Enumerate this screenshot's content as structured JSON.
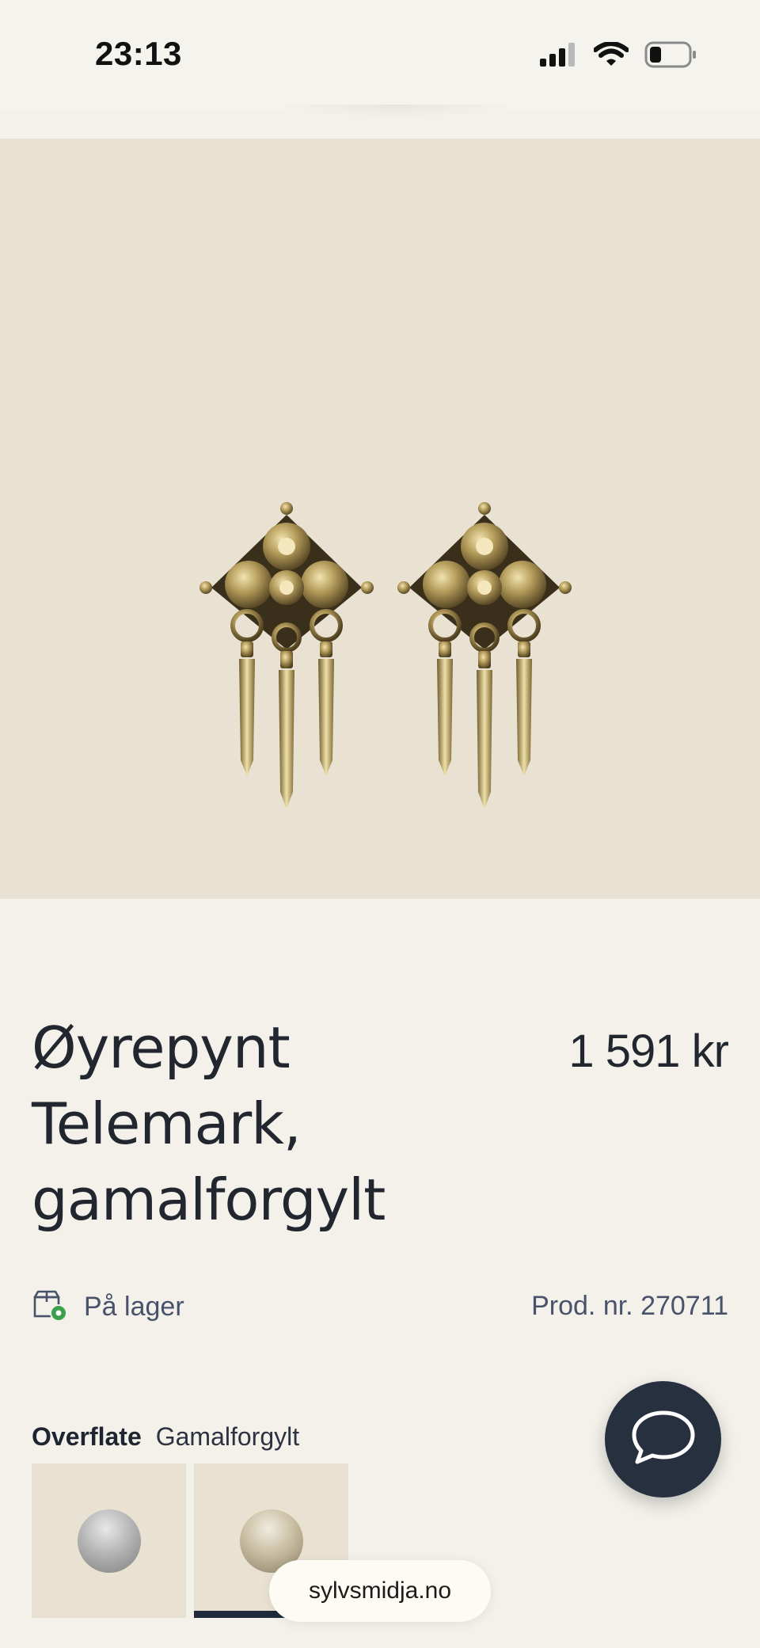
{
  "status_bar": {
    "time": "23:13",
    "icons": [
      "cellular-signal-icon",
      "wifi-icon",
      "battery-icon"
    ]
  },
  "hero": {
    "image": "gold-filigree-earrings-pair",
    "background": "#e9e2d2"
  },
  "product": {
    "title": "Øyrepynt Telemark, gamalforgylt",
    "price": "1 591 kr",
    "stock_label": "På lager",
    "stock_icon": "box-in-stock-icon",
    "product_number": "Prod. nr. 270711"
  },
  "surface": {
    "label": "Overflate",
    "value": "Gamalforgylt",
    "options": [
      {
        "name": "sølv",
        "selected": false
      },
      {
        "name": "gamalforgylt",
        "selected": true
      }
    ]
  },
  "chat": {
    "icon": "chat-bubble-icon"
  },
  "browser": {
    "url": "sylvsmidja.no"
  },
  "colors": {
    "page_bg": "#f3f1ea",
    "text_primary": "#22262f",
    "text_muted": "#48526a",
    "chat_button": "#26303f",
    "stock_ok": "#3aa14a"
  }
}
